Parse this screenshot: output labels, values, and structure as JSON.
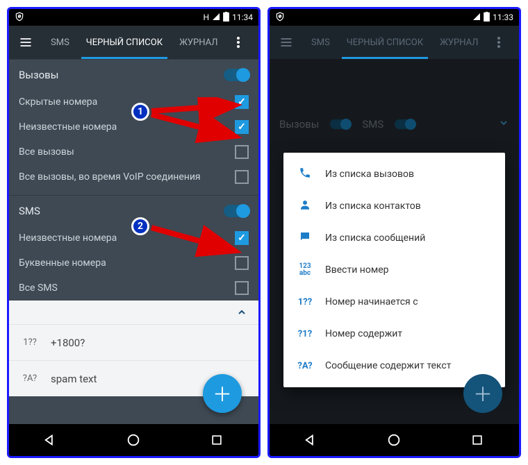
{
  "left": {
    "status": {
      "h_indicator": "H",
      "time": "11:34"
    },
    "tabs": {
      "sms": "SMS",
      "blacklist": "ЧЕРНЫЙ СПИСОК",
      "journal": "ЖУРНАЛ"
    },
    "calls": {
      "heading": "Вызовы",
      "items": [
        {
          "label": "Скрытые номера",
          "checked": true
        },
        {
          "label": "Неизвестные номера",
          "checked": true
        },
        {
          "label": "Все вызовы",
          "checked": false
        },
        {
          "label": "Все вызовы, во время VoIP соединения",
          "checked": false
        }
      ]
    },
    "sms": {
      "heading": "SMS",
      "items": [
        {
          "label": "Неизвестные номера",
          "checked": true
        },
        {
          "label": "Буквенные номера",
          "checked": false
        },
        {
          "label": "Все SMS",
          "checked": false
        }
      ]
    },
    "list": [
      {
        "icon": "1??",
        "text": "+1800?"
      },
      {
        "icon": "?A?",
        "text": "spam text"
      }
    ],
    "badges": {
      "one": "1",
      "two": "2"
    }
  },
  "right": {
    "status": {
      "time": "11:33"
    },
    "tabs": {
      "sms": "SMS",
      "blacklist": "ЧЕРНЫЙ СПИСОК",
      "journal": "ЖУРНАЛ"
    },
    "quick": {
      "calls": "Вызовы",
      "sms": "SMS"
    },
    "menu": [
      {
        "icon": "phone",
        "label": "Из списка вызовов"
      },
      {
        "icon": "person",
        "label": "Из списка контактов"
      },
      {
        "icon": "message",
        "label": "Из списка сообщений"
      },
      {
        "icon": "123abc",
        "label": "Ввести номер"
      },
      {
        "icon": "1??",
        "label": "Номер начинается с"
      },
      {
        "icon": "?1?",
        "label": "Номер содержит"
      },
      {
        "icon": "?A?",
        "label": "Сообщение содержит текст"
      }
    ]
  }
}
